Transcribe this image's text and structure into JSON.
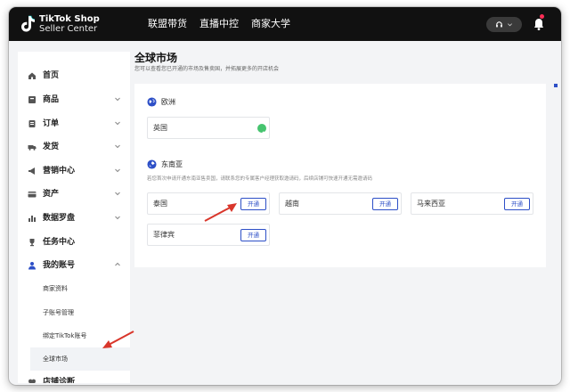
{
  "brand": {
    "line1": "TikTok Shop",
    "line2": "Seller Center"
  },
  "topnav": [
    "联盟带货",
    "直播中控",
    "商家大学"
  ],
  "sidebar": {
    "items": [
      {
        "label": "首页",
        "icon": "home-icon"
      },
      {
        "label": "商品",
        "icon": "product-icon"
      },
      {
        "label": "订单",
        "icon": "order-icon"
      },
      {
        "label": "发货",
        "icon": "shipping-icon"
      },
      {
        "label": "营销中心",
        "icon": "megaphone-icon"
      },
      {
        "label": "资产",
        "icon": "wallet-icon"
      },
      {
        "label": "数据罗盘",
        "icon": "chart-icon"
      },
      {
        "label": "任务中心",
        "icon": "trophy-icon"
      },
      {
        "label": "我的账号",
        "icon": "user-icon"
      },
      {
        "label": "店铺诊断",
        "icon": "diagnosis-icon"
      }
    ],
    "account_sub": [
      "商家资料",
      "子账号管理",
      "绑定TikTok账号",
      "全球市场"
    ]
  },
  "page": {
    "title": "全球市场",
    "subtitle": "您可以查看您已开通的市场及售卖国，并拓展更多的开店机会"
  },
  "regions": {
    "europe": {
      "name": "欧洲",
      "markets": [
        {
          "name": "英国"
        }
      ]
    },
    "sea": {
      "name": "东南亚",
      "desc": "若您首次申请开通东南亚售卖国，请联系您的专属客户经理获取邀请码，后续店铺可快速开通无需邀请码",
      "markets": [
        {
          "name": "泰国"
        },
        {
          "name": "越南"
        },
        {
          "name": "马来西亚"
        },
        {
          "name": "菲律宾"
        }
      ]
    }
  },
  "open_label": "开通",
  "colors": {
    "accent": "#2d4fc7",
    "topbar": "#111111",
    "success": "#46c46f",
    "annotation_arrow": "#d9362b"
  }
}
